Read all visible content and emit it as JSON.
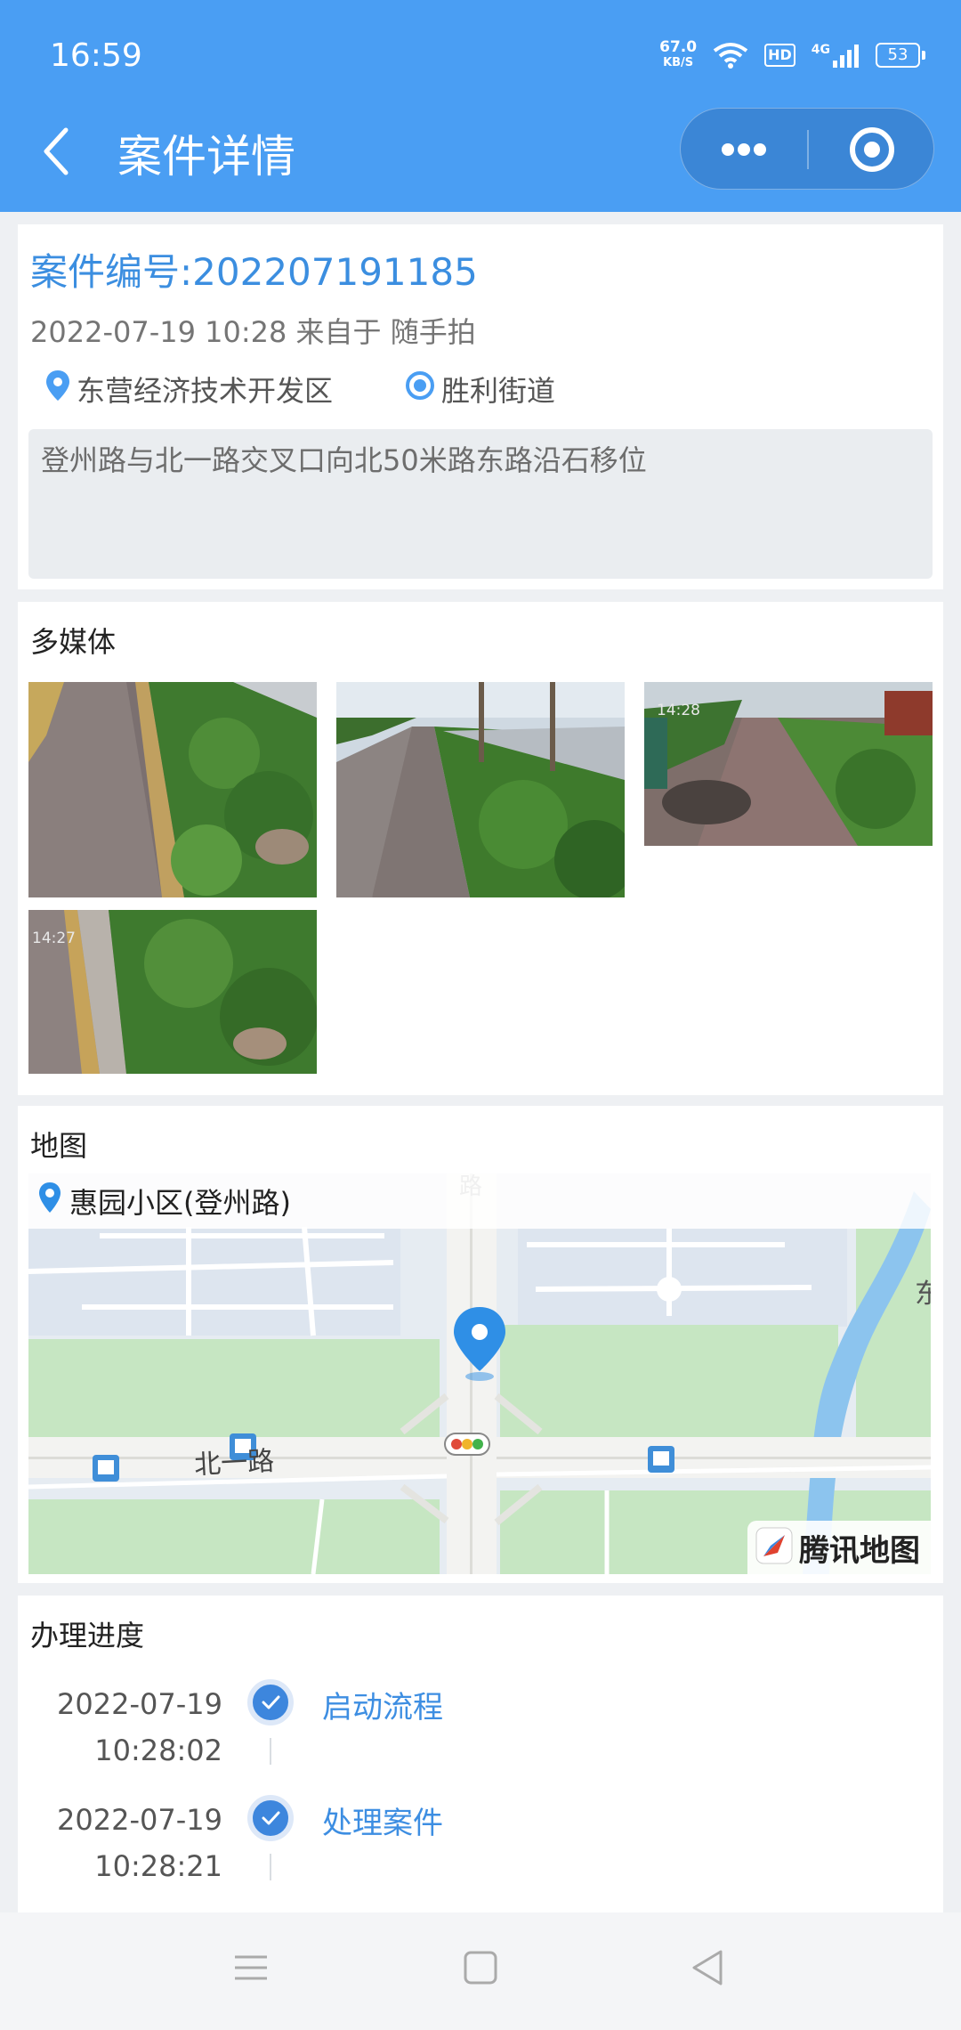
{
  "status": {
    "time": "16:59",
    "speed_value": "67.0",
    "speed_unit": "KB/S",
    "hd": "HD",
    "network": "4G",
    "battery": "53"
  },
  "navbar": {
    "title": "案件详情",
    "back_icon": "back-chevron-icon",
    "more_icon": "more-dots-icon",
    "close_icon": "target-circle-icon"
  },
  "case": {
    "number": "案件编号:202207191185",
    "meta": "2022-07-19 10:28 来自于 随手拍",
    "district": "东营经济技术开发区",
    "street": "胜利街道",
    "description": "登州路与北一路交叉口向北50米路东路沿石移位"
  },
  "media": {
    "title": "多媒体",
    "photos": [
      {
        "name": "photo-1"
      },
      {
        "name": "photo-2"
      },
      {
        "name": "photo-3",
        "stamp": "14:28"
      },
      {
        "name": "photo-4",
        "stamp": "14:27"
      }
    ]
  },
  "map": {
    "title": "地图",
    "place": "惠园小区(登州路)",
    "road_label": "北一路",
    "top_label": "路",
    "edge_label": "东",
    "brand": "腾讯地图"
  },
  "progress": {
    "title": "办理进度",
    "steps": [
      {
        "date": "2022-07-19",
        "time": "10:28:02",
        "label": "启动流程"
      },
      {
        "date": "2022-07-19",
        "time": "10:28:21",
        "label": "处理案件"
      }
    ]
  },
  "colors": {
    "primary": "#4a9ef3",
    "accent": "#3b8ee0",
    "background": "#eef0f3"
  }
}
